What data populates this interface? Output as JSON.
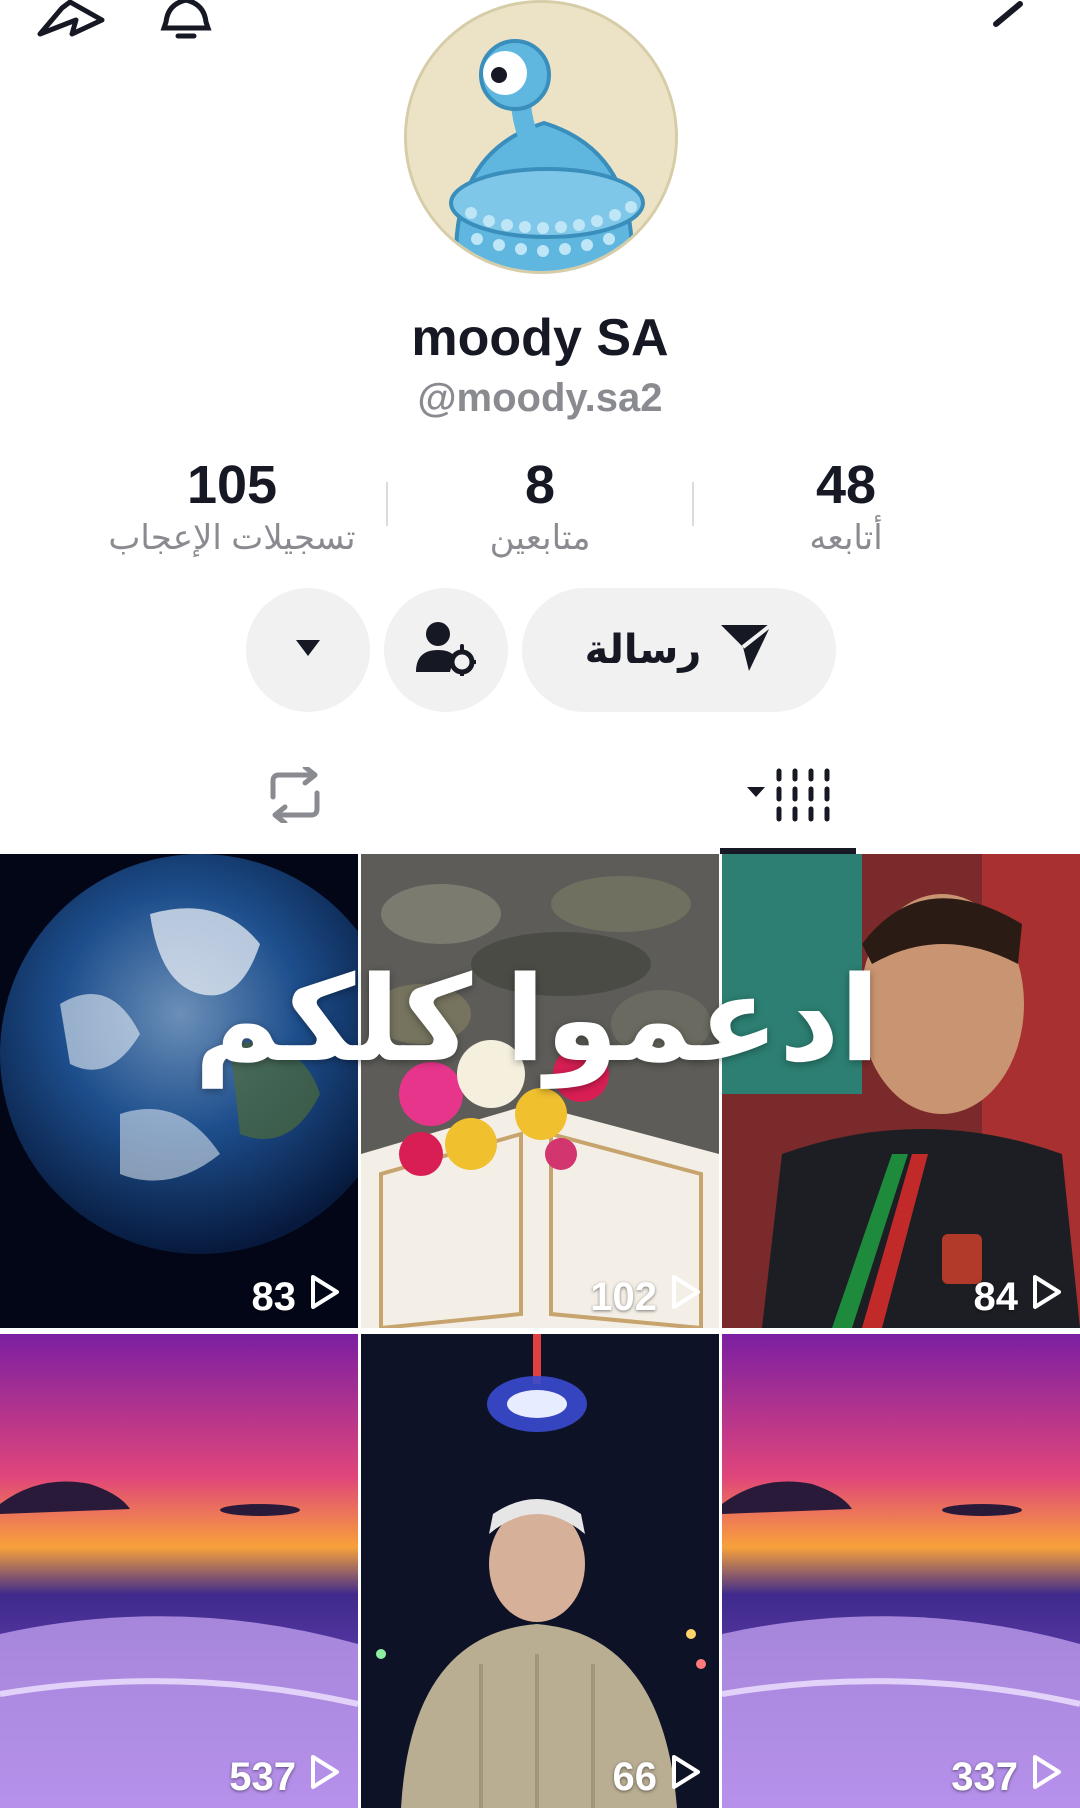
{
  "profile": {
    "display_name": "moody SA",
    "username": "@moody.sa2"
  },
  "stats": {
    "likes": {
      "value": "105",
      "label": "تسجيلات الإعجاب"
    },
    "followers": {
      "value": "8",
      "label": "متابعين"
    },
    "following": {
      "value": "48",
      "label": "أتابعه"
    }
  },
  "actions": {
    "message_label": "رسالة"
  },
  "icons": {
    "share": "share-icon",
    "bell": "bell-icon",
    "back": "chevron-right-icon",
    "more": "caret-down-icon",
    "add_user": "user-settings-icon",
    "send": "send-icon",
    "repost": "repost-icon",
    "videos": "videos-grid-icon"
  },
  "videos": [
    {
      "views": "83"
    },
    {
      "views": "102"
    },
    {
      "views": "84"
    },
    {
      "views": "537"
    },
    {
      "views": "66"
    },
    {
      "views": "337"
    }
  ],
  "overlay_caption": "ادعموا كلكم"
}
